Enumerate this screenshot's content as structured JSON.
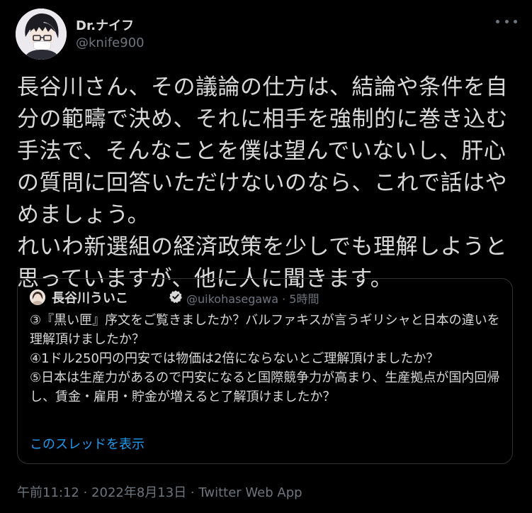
{
  "author": {
    "name": "Dr.ナイフ",
    "handle": "@knife900"
  },
  "tweet": {
    "text": "長谷川さん、その議論の仕方は、結論や条件を自分の範疇で決め、それに相手を強制的に巻き込む手法で、そんなことを僕は望んでいないし、肝心の質問に回答いただけないのなら、これで話はやめましょう。\nれいわ新選組の経済政策を少しでも理解しようと思っていますが、他に人に聞きます。"
  },
  "quote": {
    "name": "長谷川ういこ",
    "handle_time": "@uikohasegawa · 5時間",
    "text": "③『黒い匣』序文をご覧きましたか？バルファキスが言うギリシャと日本の違いを理解頂けましたか？\n④1ドル250円の円安では物価は2倍にならないとご理解頂けましたか？\n⑤日本は生産力があるので円安になると国際競争力が高まり、生産拠点が国内回帰し、賃金・雇用・貯金が増えると了解頂けましたか？",
    "show_thread": "このスレッドを表示"
  },
  "meta": {
    "timestamp": "午前11:12 · 2022年8月13日 · Twitter Web App"
  },
  "colors": {
    "background": "#000000",
    "text": "#d9d9d9",
    "secondary": "#6e767d",
    "link": "#1d9bf0",
    "border": "#2f3336"
  }
}
